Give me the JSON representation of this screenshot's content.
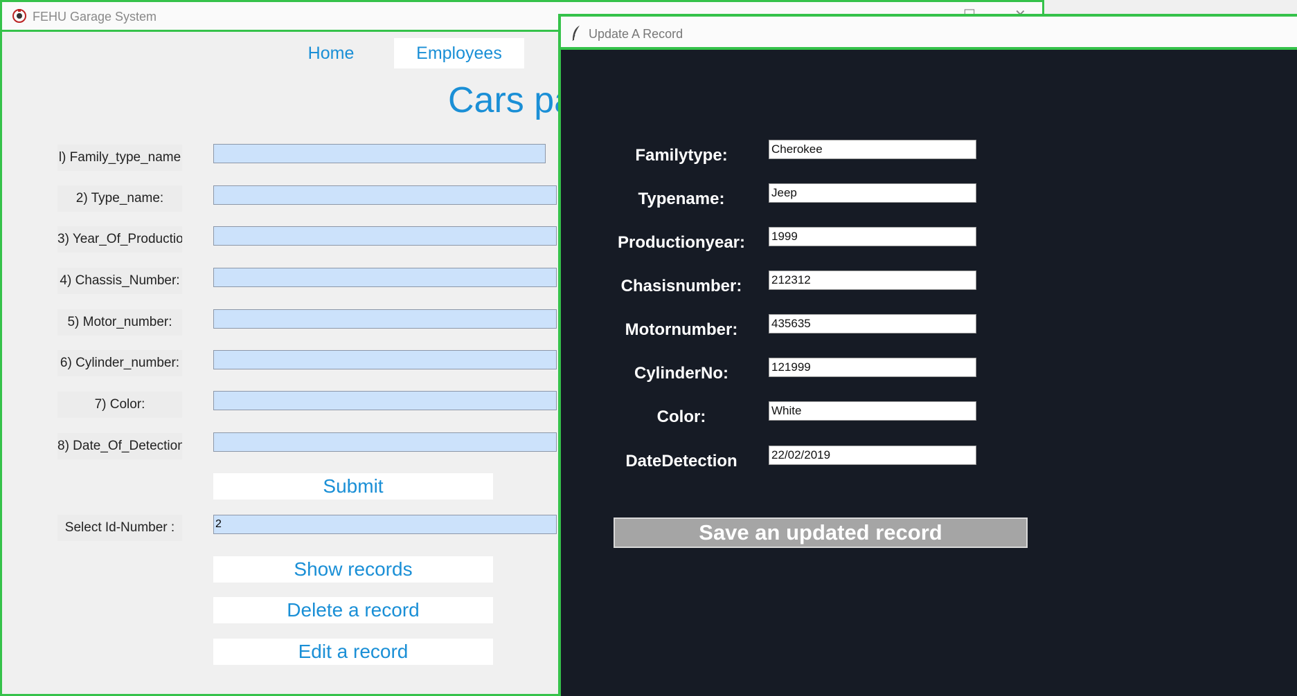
{
  "main_window": {
    "title": "FEHU Garage System",
    "nav": {
      "home": "Home",
      "employees": "Employees"
    },
    "page_title": "Cars pa",
    "fields": [
      {
        "label": "l) Family_type_name",
        "value": ""
      },
      {
        "label": "2) Type_name:",
        "value": ""
      },
      {
        "label": "3) Year_Of_Productio",
        "value": ""
      },
      {
        "label": "4) Chassis_Number:",
        "value": ""
      },
      {
        "label": "5) Motor_number:",
        "value": ""
      },
      {
        "label": "6) Cylinder_number:",
        "value": ""
      },
      {
        "label": "7) Color:",
        "value": ""
      },
      {
        "label": "8) Date_Of_Detection",
        "value": ""
      }
    ],
    "submit_label": "Submit",
    "select_id": {
      "label": "Select Id-Number :",
      "value": "2"
    },
    "buttons": {
      "show": "Show records",
      "delete": "Delete a record",
      "edit": "Edit a record"
    }
  },
  "update_window": {
    "title": "Update A Record",
    "fields": [
      {
        "label": "Familytype:",
        "value": "Cherokee"
      },
      {
        "label": "Typename:",
        "value": "Jeep"
      },
      {
        "label": "Productionyear:",
        "value": "1999"
      },
      {
        "label": "Chasisnumber:",
        "value": "212312"
      },
      {
        "label": "Motornumber:",
        "value": "435635"
      },
      {
        "label": "CylinderNo:",
        "value": "121999"
      },
      {
        "label": "Color:",
        "value": "White"
      },
      {
        "label": "DateDetection",
        "value": "22/02/2019"
      }
    ],
    "save_label": "Save an updated record"
  }
}
